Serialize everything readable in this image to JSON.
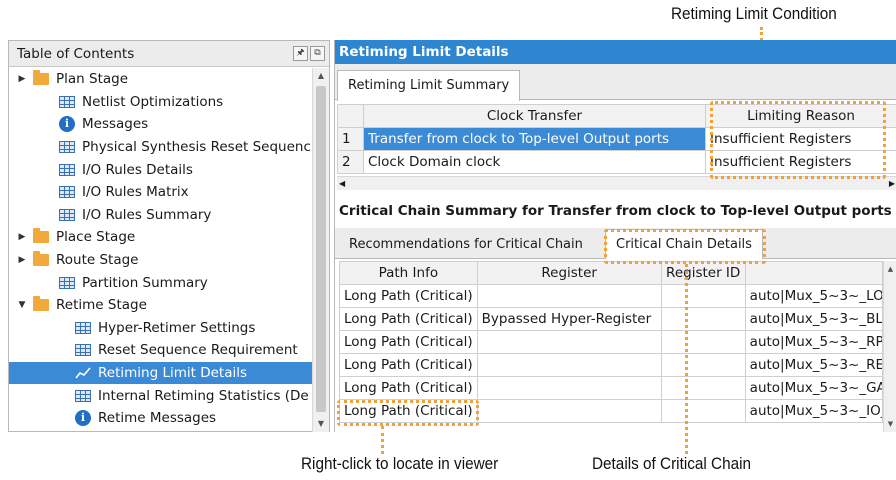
{
  "callouts": {
    "limit_condition": "Retiming Limit Condition",
    "right_click": "Right-click to locate in viewer",
    "critical_details": "Details of Critical Chain"
  },
  "toc": {
    "title": "Table of Contents",
    "buttons": [
      "pin-icon",
      "restore-icon"
    ],
    "items": [
      {
        "label": "Plan Stage",
        "icon": "folder-icon",
        "indent": 0,
        "arrow": "collapsed"
      },
      {
        "label": "Netlist Optimizations",
        "icon": "table-icon",
        "indent": 1
      },
      {
        "label": "Messages",
        "icon": "info-icon",
        "indent": 1
      },
      {
        "label": "Physical Synthesis Reset Sequenc",
        "icon": "table-icon",
        "indent": 1
      },
      {
        "label": "I/O Rules Details",
        "icon": "table-icon",
        "indent": 1
      },
      {
        "label": "I/O Rules Matrix",
        "icon": "table-icon",
        "indent": 1
      },
      {
        "label": "I/O Rules Summary",
        "icon": "table-icon",
        "indent": 1
      },
      {
        "label": "Place Stage",
        "icon": "folder-icon",
        "indent": 0,
        "arrow": "collapsed"
      },
      {
        "label": "Route Stage",
        "icon": "folder-icon",
        "indent": 0,
        "arrow": "collapsed"
      },
      {
        "label": "Partition Summary",
        "icon": "table-icon",
        "indent": 1
      },
      {
        "label": "Retime Stage",
        "icon": "folder-open-icon",
        "indent": 0,
        "arrow": "expanded"
      },
      {
        "label": "Hyper-Retimer Settings",
        "icon": "table-icon",
        "indent": 2
      },
      {
        "label": "Reset Sequence Requirement",
        "icon": "table-icon",
        "indent": 2
      },
      {
        "label": "Retiming Limit Details",
        "icon": "chart-icon",
        "indent": 2,
        "selected": true
      },
      {
        "label": "Internal Retiming Statistics (De",
        "icon": "table-icon",
        "indent": 2
      },
      {
        "label": "Retime Messages",
        "icon": "info-icon",
        "indent": 2
      }
    ]
  },
  "panel": {
    "title": "Retiming Limit Details",
    "summary_tab": "Retiming Limit Summary",
    "summary_table": {
      "headers": [
        "",
        "Clock Transfer",
        "Limiting Reason"
      ],
      "rows": [
        [
          "1",
          "Transfer from clock to Top-level Output ports",
          "Insufficient Registers"
        ],
        [
          "2",
          "Clock Domain clock",
          "Insufficient Registers"
        ]
      ]
    },
    "chain_title": "Critical Chain Summary for Transfer from clock to Top-level Output ports",
    "chain_tabs": [
      "Recommendations for Critical Chain",
      "Critical Chain Details"
    ],
    "chain_table": {
      "headers": [
        "Path Info",
        "Register",
        "Register ID",
        ""
      ],
      "rows": [
        [
          "Long Path (Critical)",
          "",
          "",
          "auto|Mux_5~3~_LO"
        ],
        [
          "Long Path (Critical)",
          "Bypassed Hyper-Register",
          "",
          "auto|Mux_5~3~_BL"
        ],
        [
          "Long Path (Critical)",
          "",
          "",
          "auto|Mux_5~3~_RP"
        ],
        [
          "Long Path (Critical)",
          "",
          "",
          "auto|Mux_5~3~_RE"
        ],
        [
          "Long Path (Critical)",
          "",
          "",
          "auto|Mux_5~3~_GA"
        ],
        [
          "Long Path (Critical)",
          "",
          "",
          "auto|Mux_5~3~_IO_"
        ]
      ]
    }
  },
  "colors": {
    "accent": "#2f86d0",
    "selection": "#3b8ad6",
    "callout": "#f0a13a",
    "folder": "#f2a83a"
  }
}
